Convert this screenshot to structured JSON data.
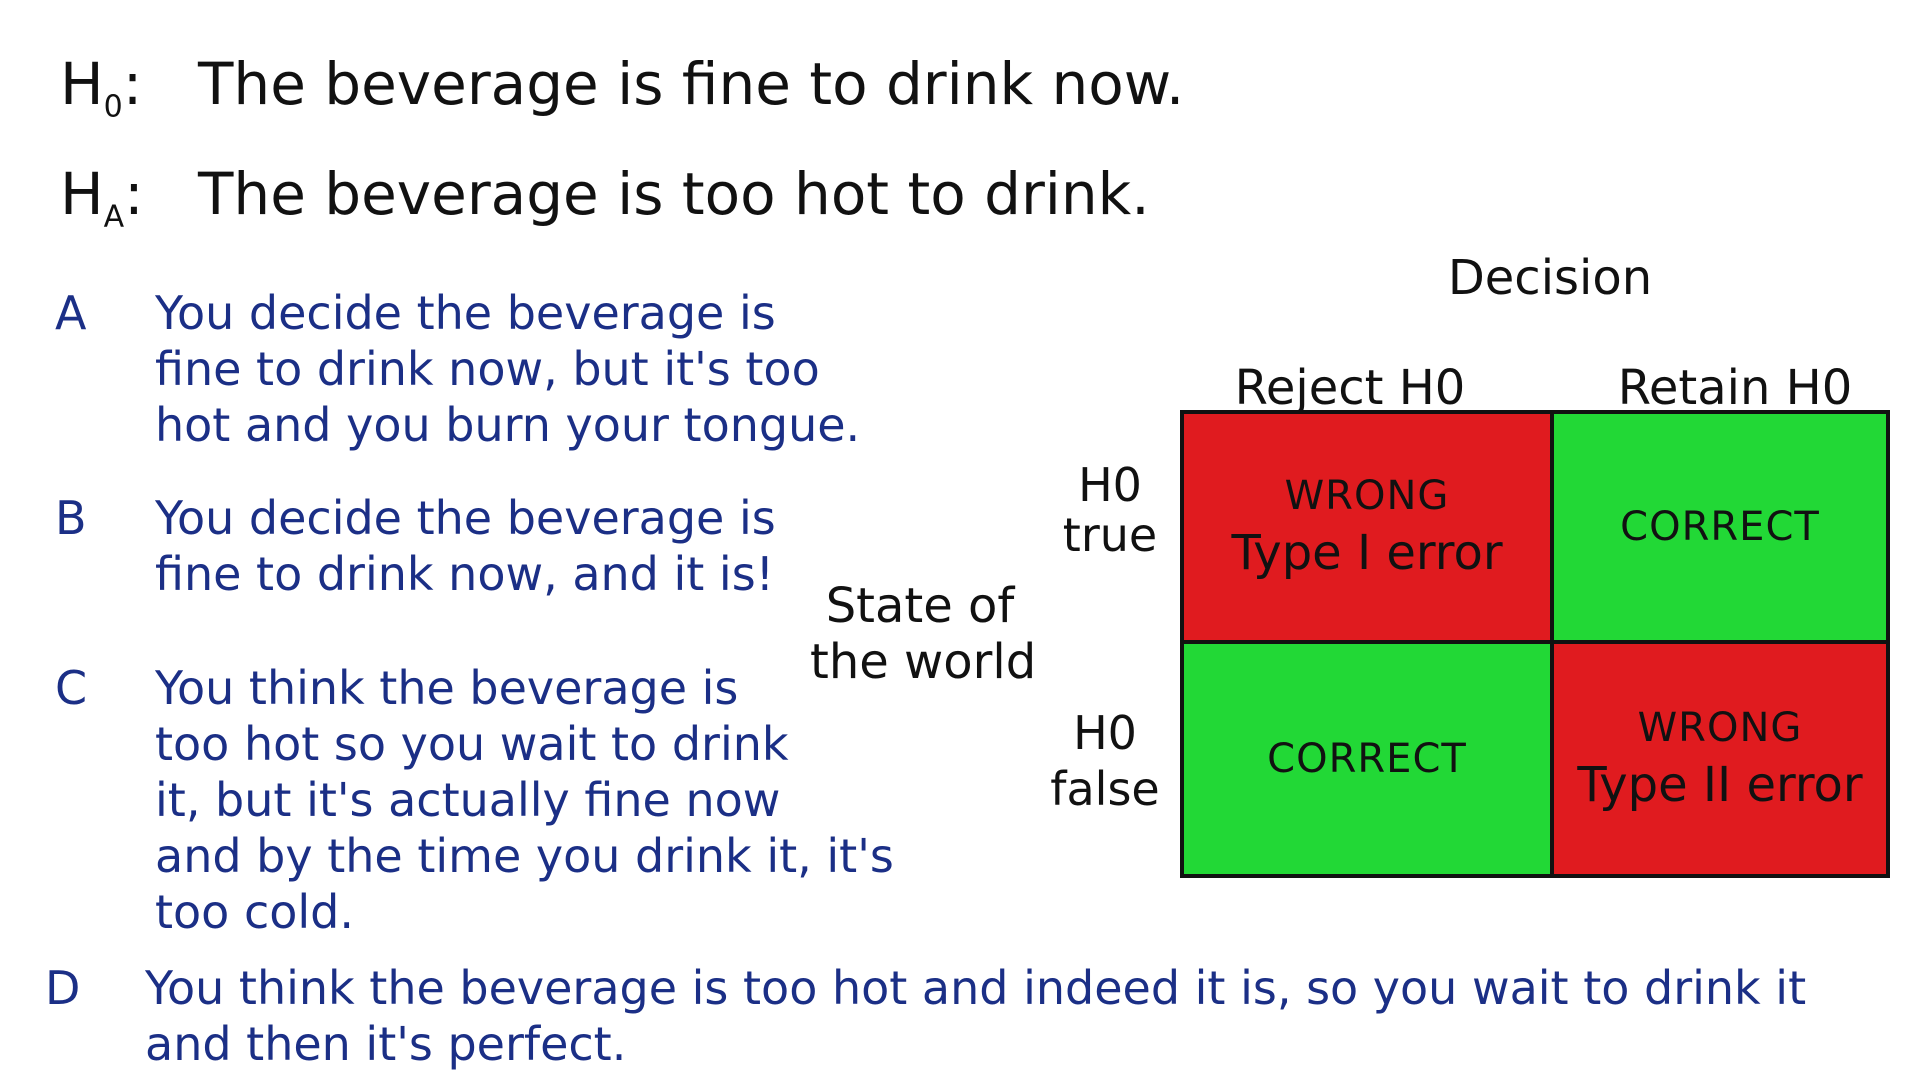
{
  "hypotheses": {
    "null": {
      "symbol": "H",
      "sub": "0",
      "colon": ":",
      "text": "The beverage is fine to drink now."
    },
    "alt": {
      "symbol": "H",
      "sub": "A",
      "colon": ":",
      "text": "The beverage is too hot to drink."
    }
  },
  "scenarios": [
    {
      "letter": "A",
      "lines": [
        "You decide the beverage is",
        "fine to drink now, but it's too",
        "hot and you burn your tongue."
      ]
    },
    {
      "letter": "B",
      "lines": [
        "You decide the beverage is",
        "fine to drink now, and it is!"
      ]
    },
    {
      "letter": "C",
      "lines": [
        "You think the beverage is",
        "too hot so you wait to drink",
        "it, but it's actually fine now",
        "and by the time you drink it, it's",
        "too cold."
      ]
    },
    {
      "letter": "D",
      "lines": [
        "You think the beverage is too hot and indeed it is, so you wait to drink it",
        "and then it's perfect."
      ]
    }
  ],
  "table": {
    "decision_label": "Decision",
    "col_reject": "Reject H0",
    "col_retain": "Retain H0",
    "state_label_line1": "State of",
    "state_label_line2": "the world",
    "row_true_line1": "H0",
    "row_true_line2": "true",
    "row_false_line1": "H0",
    "row_false_line2": "false",
    "cells": {
      "true_reject": {
        "verdict": "WRONG",
        "detail": "Type I error",
        "color": "#e01b1f"
      },
      "true_retain": {
        "verdict": "CORRECT",
        "color": "#22d836"
      },
      "false_reject": {
        "verdict": "CORRECT",
        "color": "#22d836"
      },
      "false_retain": {
        "verdict": "WRONG",
        "detail": "Type II error",
        "color": "#e01b1f"
      }
    }
  },
  "colors": {
    "ink": "#111111",
    "scenario_ink": "#1b2f86",
    "wrong": "#e01b1f",
    "correct": "#22d836"
  }
}
